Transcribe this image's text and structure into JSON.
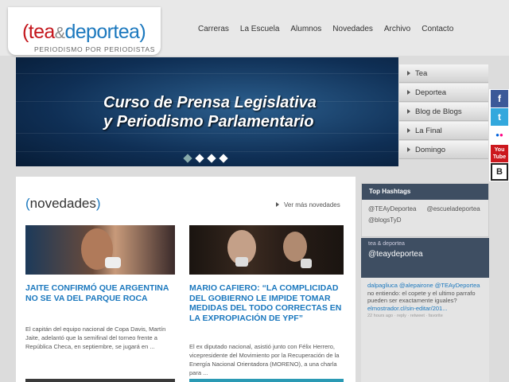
{
  "logo": {
    "bracket_open": "(",
    "tea": "tea",
    "amp": "&",
    "deportea": "deportea",
    "bracket_close": ")",
    "tagline": "PERIODISMO POR PERIODISTAS"
  },
  "nav": [
    "Carreras",
    "La Escuela",
    "Alumnos",
    "Novedades",
    "Archivo",
    "Contacto"
  ],
  "hero": {
    "line1": "Curso de Prensa Legislativa",
    "line2": "y Periodismo Parlamentario",
    "slides": 4,
    "active_slide": 1
  },
  "side_tabs": [
    "Tea",
    "Deportea",
    "Blog de Blogs",
    "La Final",
    "Domingo"
  ],
  "social": [
    {
      "name": "facebook-icon",
      "glyph": "f",
      "color": "#3b5998"
    },
    {
      "name": "twitter-icon",
      "glyph": "t",
      "color": "#33a8dd"
    },
    {
      "name": "flickr-icon",
      "glyph": "••",
      "color": "#ffffff"
    },
    {
      "name": "youtube-icon",
      "glyph": "You",
      "color": "#cc181e"
    },
    {
      "name": "blogger-icon",
      "glyph": "B",
      "color": "#ffffff"
    }
  ],
  "novedades": {
    "bracket_open": "(",
    "title": "novedades",
    "bracket_close": ")",
    "ver_mas": "Ver más novedades",
    "articles": [
      {
        "title": "JAITE CONFIRMÓ QUE ARGENTINA NO SE VA DEL PARQUE ROCA",
        "body": "El capitán del equipo nacional de Copa Davis, Martín Jaite, adelantó que la semifinal del torneo frente a República Checa, en septiembre, se jugará en ..."
      },
      {
        "title": "MARIO CAFIERO: “LA COMPLICIDAD DEL GOBIERNO LE IMPIDE TOMAR MEDIDAS DEL TODO CORRECTAS EN LA EXPROPIACIÓN DE YPF”",
        "body": "El ex diputado nacional, asistió junto con Félix Herrero, vicepresidente del Movimiento por la Recuperación de la Energía Nacional Orientadora (MORENO), a una charla para ..."
      }
    ]
  },
  "hashtags": {
    "header": "Top Hashtags",
    "tags": [
      "@TEAyDeportea",
      "@escueladeportea",
      "@blogsTyD"
    ]
  },
  "twitter": {
    "small": "tea & deportea",
    "handle": "@teaydeportea",
    "tweet_user": "dalpagliuca",
    "tweet_mention": "@alepairone",
    "tweet_mention2": "@TEAyDeportea",
    "tweet_text": "no entiendo: el copete y el ultimo parrafo pueden ser exactamente iguales?",
    "tweet_link": "elmostrador.cl/sin-editar/201...",
    "tweet_meta": "22 hours ago · reply · retweet · favorite"
  },
  "colors": {
    "brand_red": "#c4161c",
    "brand_blue": "#1b78be",
    "panel_dark": "#3e4e62"
  }
}
